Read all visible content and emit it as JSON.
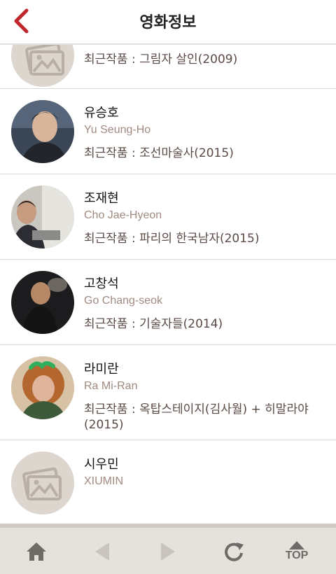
{
  "header": {
    "title": "영화정보",
    "back_icon": "chevron-left-icon",
    "accent": "#c0272d"
  },
  "people": [
    {
      "name": "",
      "roman": "",
      "recent": "최근작품 : 그림자 살인(2009)",
      "photo": "placeholder"
    },
    {
      "name": "유승호",
      "roman": "Yu Seung-Ho",
      "recent": "최근작품 : 조선마술사(2015)",
      "photo": "portrait"
    },
    {
      "name": "조재현",
      "roman": "Cho Jae-Hyeon",
      "recent": "최근작품 : 파리의 한국남자(2015)",
      "photo": "portrait"
    },
    {
      "name": "고창석",
      "roman": "Go Chang-seok",
      "recent": "최근작품 : 기술자들(2014)",
      "photo": "portrait"
    },
    {
      "name": "라미란",
      "roman": "Ra Mi-Ran",
      "recent": "최근작품 : 옥탑스테이지(김사월) + 히말라야(2015)",
      "photo": "portrait"
    },
    {
      "name": "시우민",
      "roman": "XIUMIN",
      "recent": "",
      "photo": "placeholder"
    }
  ],
  "bottom_bar": {
    "home_icon": "home-icon",
    "prev_icon": "arrow-left-icon",
    "next_icon": "arrow-right-icon",
    "refresh_icon": "refresh-icon",
    "top_label": "TOP"
  }
}
